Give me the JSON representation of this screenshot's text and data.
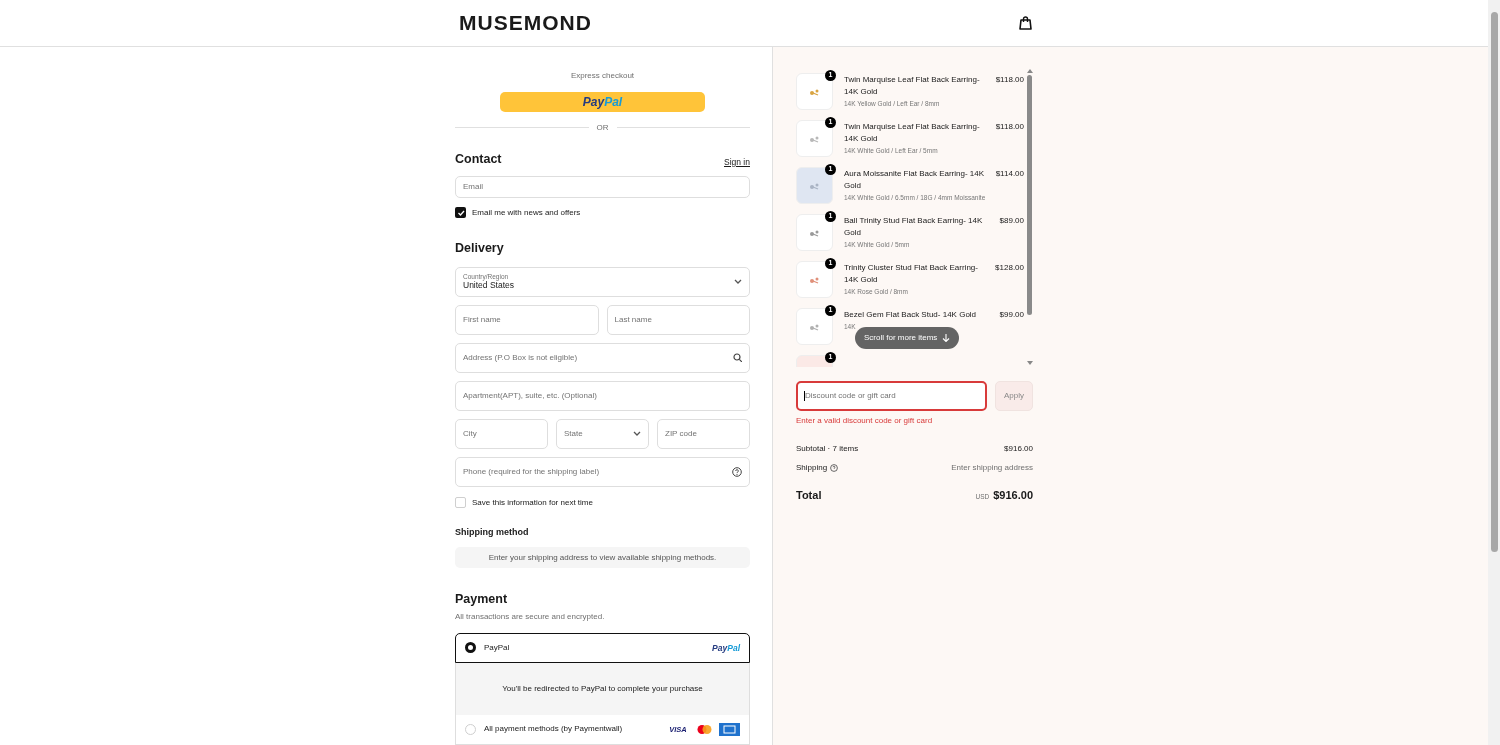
{
  "header": {
    "logo": "MUSEMOND"
  },
  "express": {
    "label": "Express checkout",
    "button": "PayPal",
    "divider": "OR"
  },
  "contact": {
    "title": "Contact",
    "link": "Sign in",
    "email": {
      "placeholder": "Email"
    },
    "newsletter": {
      "label": "Email me with news and offers",
      "checked": true
    }
  },
  "delivery": {
    "title": "Delivery",
    "country": {
      "kind": "select",
      "label": "Country/Region",
      "value": "United States"
    },
    "name_fields": [
      {
        "kind": "text",
        "placeholder": "First name"
      },
      {
        "kind": "text",
        "placeholder": "Last name"
      }
    ],
    "address": {
      "kind": "search",
      "placeholder": "Address (P.O Box is not eligible)"
    },
    "apartment": {
      "kind": "text",
      "placeholder": "Apartment(APT), suite, etc. (Optional)"
    },
    "locality_fields": [
      {
        "kind": "text",
        "placeholder": "City"
      },
      {
        "kind": "select",
        "placeholder": "State"
      },
      {
        "kind": "text",
        "placeholder": "ZIP code"
      }
    ],
    "phone": {
      "kind": "help",
      "placeholder": "Phone (required for the shipping label)"
    },
    "save": {
      "label": "Save this information for next time",
      "checked": false
    }
  },
  "shipping": {
    "title": "Shipping method",
    "message": "Enter your shipping address to view available shipping methods."
  },
  "payment": {
    "title": "Payment",
    "subtitle": "All transactions are secure and encrypted.",
    "options": [
      {
        "label": "PayPal",
        "selected": true,
        "brand": "PayPal",
        "detail": "You'll be redirected to PayPal to complete your purchase"
      },
      {
        "label": "All payment methods (by Paymentwall)",
        "selected": false,
        "cards": [
          "VISA"
        ]
      }
    ]
  },
  "cart": {
    "items": [
      {
        "quantity": "1",
        "name": "Twin Marquise Leaf Flat Back Earring- 14K Gold",
        "variant": "14K Yellow Gold / Left Ear / 8mm",
        "price": "$118.00",
        "color": "#d9a441"
      },
      {
        "quantity": "1",
        "name": "Twin Marquise Leaf Flat Back Earring- 14K Gold",
        "variant": "14K White Gold / Left Ear / 5mm",
        "price": "$118.00",
        "color": "#b8b8b8"
      },
      {
        "quantity": "1",
        "name": "Aura Moissanite Flat Back Earring- 14K Gold",
        "variant": "14K White Gold / 6.5mm / 18G / 4mm Moissanite",
        "price": "$114.00",
        "color": "#aab4c4"
      },
      {
        "quantity": "1",
        "name": "Ball Trinity Stud Flat Back Earring- 14K Gold",
        "variant": "14K White Gold / 5mm",
        "price": "$89.00",
        "color": "#9a9a9a"
      },
      {
        "quantity": "1",
        "name": "Trinity Cluster Stud Flat Back Earring- 14K Gold",
        "variant": "14K Rose Gold / 8mm",
        "price": "$128.00",
        "color": "#e0907a"
      },
      {
        "quantity": "1",
        "name": "Bezel Gem Flat Back Stud- 14K Gold",
        "variant": "14K",
        "price": "$99.00",
        "color": "#b0b0b0"
      },
      {
        "quantity": "1"
      }
    ],
    "scroll_hint": "Scroll for more items",
    "discount": {
      "placeholder": "Discount code or gift card",
      "button": "Apply",
      "error": "Enter a valid discount code or gift card"
    },
    "subtotal": {
      "label": "Subtotal · 7 items",
      "value": "$916.00"
    },
    "shipping": {
      "label": "Shipping",
      "value": "Enter shipping address"
    },
    "total": {
      "label": "Total",
      "currency": "USD",
      "value": "$916.00"
    }
  }
}
